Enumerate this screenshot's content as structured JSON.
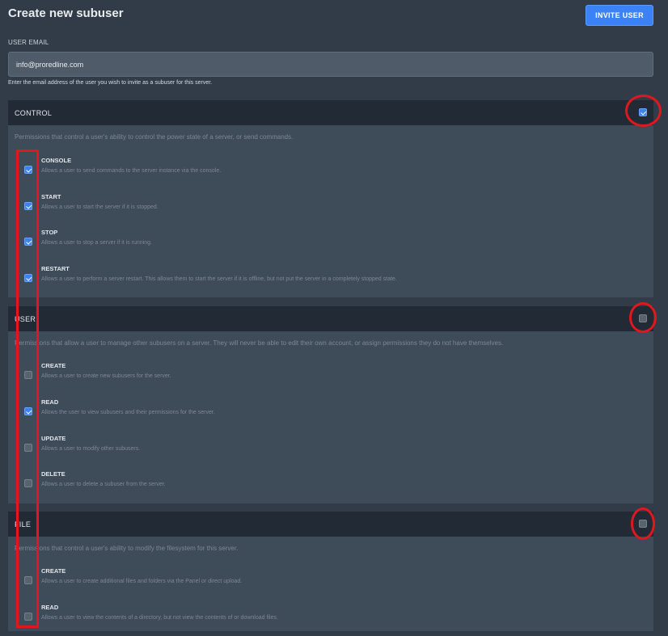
{
  "header": {
    "title": "Create new subuser",
    "invite_label": "INVITE USER"
  },
  "email": {
    "label": "USER EMAIL",
    "value": "info@proredline.com",
    "help": "Enter the email address of the user you wish to invite as a subuser for this server."
  },
  "panels": [
    {
      "title": "CONTROL",
      "all_checked": true,
      "description": "Permissions that control a user's ability to control the power state of a server, or send commands.",
      "items": [
        {
          "name": "CONSOLE",
          "description": "Allows a user to send commands to the server instance via the console.",
          "checked": true
        },
        {
          "name": "START",
          "description": "Allows a user to start the server if it is stopped.",
          "checked": true
        },
        {
          "name": "STOP",
          "description": "Allows a user to stop a server if it is running.",
          "checked": true
        },
        {
          "name": "RESTART",
          "description": "Allows a user to perform a server restart. This allows them to start the server if it is offline, but not put the server in a completely stopped state.",
          "checked": true
        }
      ]
    },
    {
      "title": "USER",
      "all_checked": false,
      "description": "Permissions that allow a user to manage other subusers on a server. They will never be able to edit their own account, or assign permissions they do not have themselves.",
      "items": [
        {
          "name": "CREATE",
          "description": "Allows a user to create new subusers for the server.",
          "checked": false
        },
        {
          "name": "READ",
          "description": "Allows the user to view subusers and their permissions for the server.",
          "checked": true
        },
        {
          "name": "UPDATE",
          "description": "Allows a user to modify other subusers.",
          "checked": false
        },
        {
          "name": "DELETE",
          "description": "Allows a user to delete a subuser from the server.",
          "checked": false
        }
      ]
    },
    {
      "title": "FILE",
      "all_checked": false,
      "description": "Permissions that control a user's ability to modify the filesystem for this server.",
      "items": [
        {
          "name": "CREATE",
          "description": "Allows a user to create additional files and folders via the Panel or direct upload.",
          "checked": false
        },
        {
          "name": "READ",
          "description": "Allows a user to view the contents of a directory, but not view the contents of or download files.",
          "checked": false
        }
      ]
    }
  ]
}
